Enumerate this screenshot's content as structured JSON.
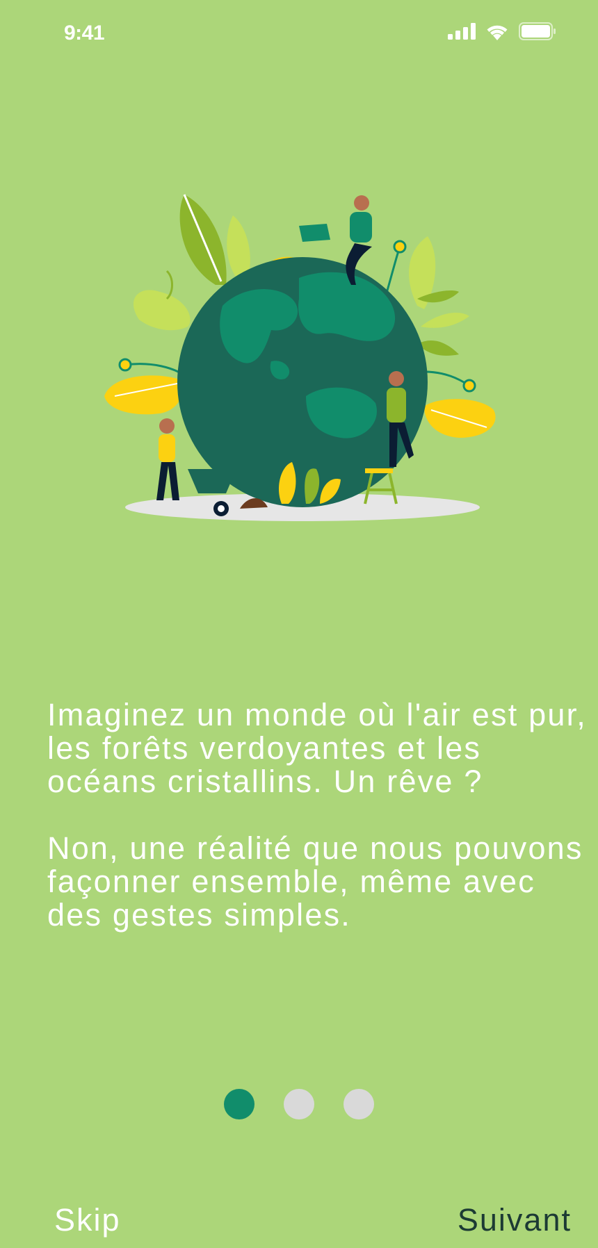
{
  "status_bar": {
    "time": "9:41",
    "icons": [
      "cellular-signal-icon",
      "wifi-icon",
      "battery-icon"
    ]
  },
  "onboarding": {
    "illustration": "earth-planting-illustration",
    "paragraphs": [
      "Imaginez un monde où l'air est pur, les forêts verdoyantes et les océans cristallins. Un rêve ?",
      "Non, une réalité que nous pouvons façonner ensemble, même avec des gestes simples."
    ],
    "pagination": {
      "current": 1,
      "total": 3
    }
  },
  "footer": {
    "skip_label": "Skip",
    "next_label": "Suivant"
  },
  "colors": {
    "background": "#acd679",
    "accent": "#118d6b",
    "inactive_dot": "#d9d9d9",
    "next_text": "#1c3a34"
  }
}
